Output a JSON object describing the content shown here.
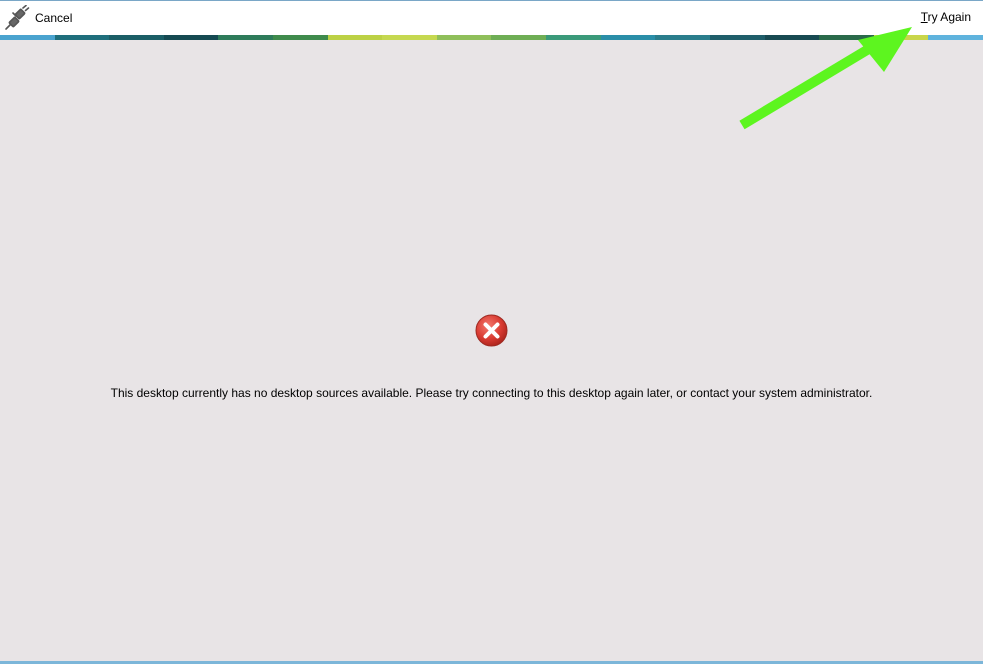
{
  "toolbar": {
    "cancel_label": "Cancel",
    "try_again_mnemonic": "T",
    "try_again_rest": "ry Again"
  },
  "icons": {
    "cancel": "plug-disconnect-icon",
    "error": "error-x-icon",
    "annotation": "arrow-annotation-icon"
  },
  "colors": {
    "error_red": "#d93b32",
    "annotation_green": "#5df51f",
    "background": "#e8e4e6"
  },
  "stripe_colors": [
    "#4aa3cf",
    "#1f6f7c",
    "#1b5e66",
    "#154a52",
    "#2e7b5a",
    "#3f8b4c",
    "#bcd145",
    "#c5d850",
    "#8fbf5a",
    "#6fae55",
    "#3b9a7a",
    "#2a8ea8",
    "#2a7d8c",
    "#1f5e6a",
    "#184a52",
    "#2a6a4a",
    "#c9d64a",
    "#5fb3dd"
  ],
  "main": {
    "message": "This desktop currently has no desktop sources available. Please try connecting to this desktop again later, or contact your system administrator."
  }
}
